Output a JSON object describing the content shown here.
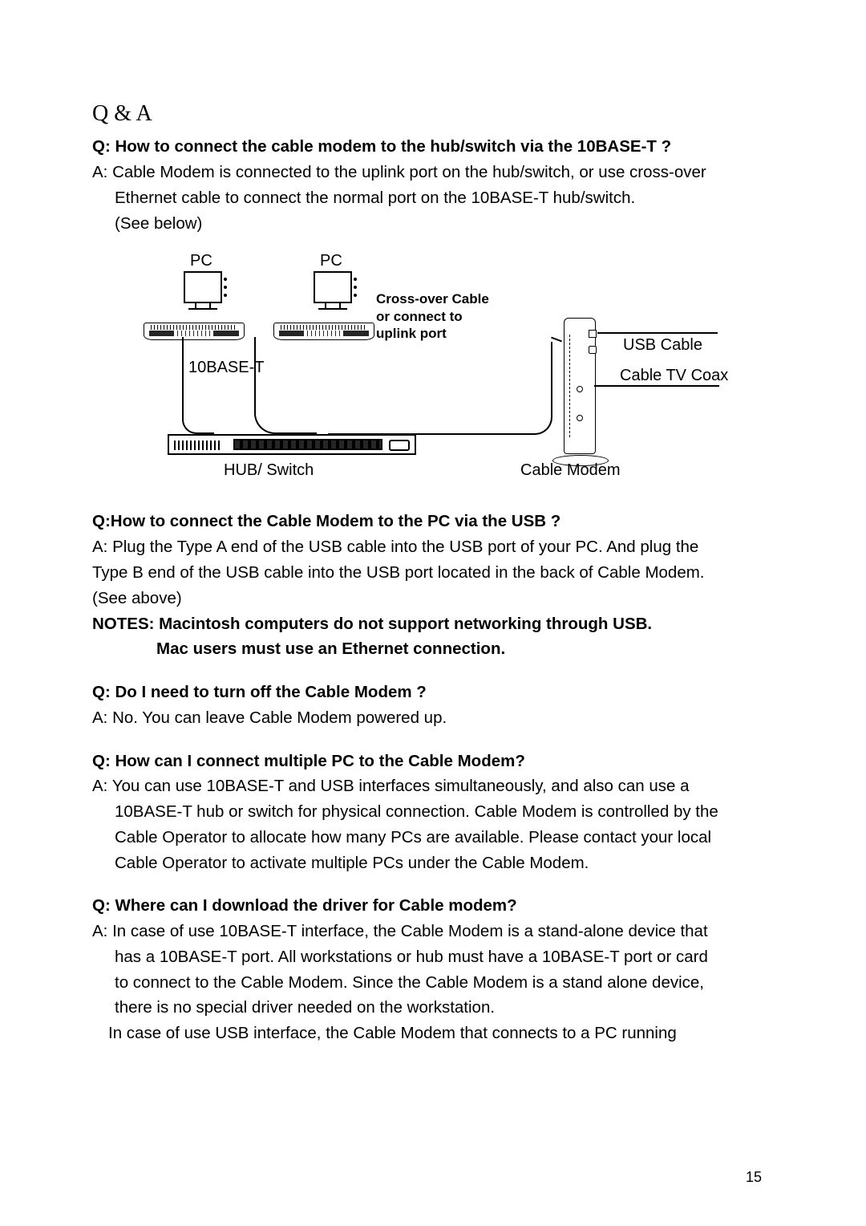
{
  "title": "Q & A",
  "qa": {
    "q1": "Q: How to connect the cable modem to the hub/switch via the 10BASE-T ?",
    "a1_line1": "A: Cable Modem is connected to the uplink port on the hub/switch, or use cross-over",
    "a1_line2": "Ethernet cable to connect the normal port on the 10BASE-T hub/switch.",
    "a1_line3": "(See below)",
    "q2": "Q:How to connect the Cable Modem to the PC via the USB ?",
    "a2_line1": "A: Plug the Type A end of the USB cable into the USB port of your PC. And plug the",
    "a2_line2": "Type B end of the USB cable into the USB port located in the back of Cable Modem.",
    "a2_line3": "(See above)",
    "notes_line1": "NOTES: Macintosh computers do not support networking through USB.",
    "notes_line2": "Mac users must use an Ethernet connection.",
    "q3": "Q: Do I need to turn off the Cable Modem ?",
    "a3": "A: No. You can leave Cable Modem powered up.",
    "q4": "Q: How can I connect multiple PC to the Cable Modem?",
    "a4_line1": "A: You can use 10BASE-T and USB interfaces simultaneously, and also can use a",
    "a4_line2": "10BASE-T hub or switch for physical connection. Cable Modem is controlled by the",
    "a4_line3": "Cable Operator to allocate how many PCs are available. Please contact your local",
    "a4_line4": "Cable Operator to activate multiple PCs under the Cable Modem.",
    "q5": "Q: Where can I download the driver for Cable modem?",
    "a5_line1": "A: In case of use 10BASE-T interface, the Cable Modem is a stand-alone device that",
    "a5_line2": "has a 10BASE-T port. All workstations or hub must have a 10BASE-T port or card",
    "a5_line3": "to connect to the Cable Modem. Since the Cable Modem is a stand alone device,",
    "a5_line4": "there is no special driver needed on the workstation.",
    "a5_line5": "In case of use USB interface, the Cable Modem that connects to a PC running"
  },
  "diagram": {
    "pc": "PC",
    "crossover_l1": "Cross-over Cable",
    "crossover_l2": "or connect to",
    "crossover_l3": "uplink port",
    "ten_base_t": "10BASE-T",
    "usb_cable": "USB Cable",
    "cable_tv": "Cable TV Coax",
    "hub_switch": "HUB/ Switch",
    "cable_modem": "Cable Modem"
  },
  "page_number": "15"
}
